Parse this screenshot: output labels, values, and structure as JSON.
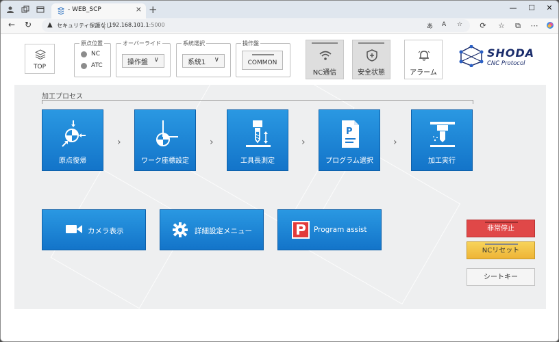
{
  "browser": {
    "tab_title": "- WEB_SCP",
    "security_text": "セキュリティ保護なし",
    "url_host": "192.168.101.1",
    "url_port": ":5000",
    "new_tab": "+"
  },
  "header": {
    "top_label": "TOP",
    "origin": {
      "title": "原点位置",
      "items": [
        "NC",
        "ATC"
      ]
    },
    "override": {
      "title": "オーバーライド",
      "value": "操作盤"
    },
    "system": {
      "title": "系統選択",
      "value": "系統1"
    },
    "panel": {
      "title": "操作盤",
      "value": "COMMON"
    },
    "nc_comm": "NC通信",
    "safety": "安全状態",
    "alarm": "アラーム",
    "logo_brand": "SHODA",
    "logo_sub": "CNC Protocol"
  },
  "process": {
    "label": "加工プロセス",
    "steps": [
      "原点復帰",
      "ワーク座標設定",
      "工具長測定",
      "プログラム選択",
      "加工実行"
    ]
  },
  "actions": {
    "camera": "カメラ表示",
    "settings": "詳細設定メニュー",
    "program_assist": "Program assist"
  },
  "side": {
    "emergency": "非常停止",
    "nc_reset": "NCリセット",
    "sheet_key": "シートキー"
  },
  "colors": {
    "step_blue": "#1c84d6",
    "emergency_red": "#e04848",
    "reset_yellow": "#f5c842"
  }
}
